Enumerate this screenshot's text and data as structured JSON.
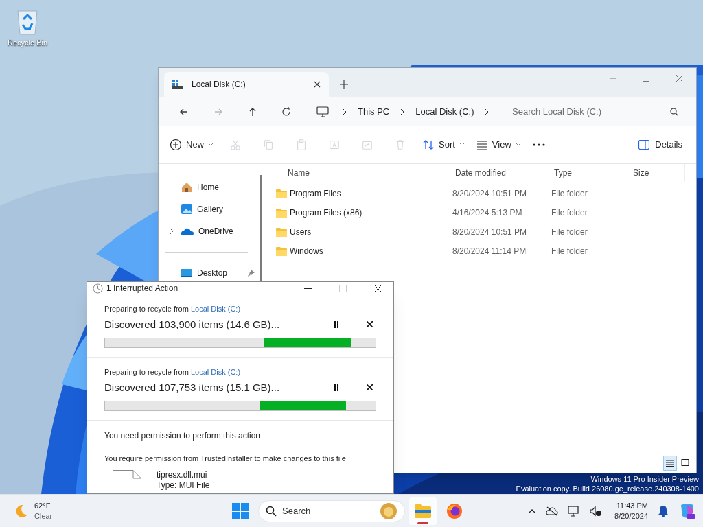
{
  "desktop": {
    "icons": [
      {
        "label": "Recycle Bin"
      }
    ],
    "watermark": [
      "Windows 11 Pro Insider Preview",
      "Evaluation copy. Build 26080.ge_release.240308-1400"
    ]
  },
  "explorer": {
    "tabs": [
      {
        "label": "Local Disk (C:)",
        "selected": true
      }
    ],
    "breadcrumb": [
      "This PC",
      "Local Disk (C:)"
    ],
    "search": {
      "placeholder": "Search Local Disk (C:)"
    },
    "commands": [
      {
        "kind": "new",
        "label": "New",
        "disabled": false
      },
      {
        "kind": "cut",
        "disabled": true
      },
      {
        "kind": "copy",
        "disabled": true
      },
      {
        "kind": "paste",
        "disabled": true
      },
      {
        "kind": "rename",
        "disabled": true
      },
      {
        "kind": "share",
        "disabled": true
      },
      {
        "kind": "delete",
        "disabled": true
      },
      {
        "kind": "sort",
        "label": "Sort",
        "disabled": false
      },
      {
        "kind": "view",
        "label": "View",
        "disabled": false
      },
      {
        "kind": "more",
        "disabled": false
      }
    ],
    "details_button": "Details",
    "sidebar": [
      {
        "kind": "home",
        "label": "Home",
        "expandable": false,
        "pinned": false
      },
      {
        "kind": "gallery",
        "label": "Gallery",
        "expandable": false,
        "pinned": false
      },
      {
        "kind": "onedrive",
        "label": "OneDrive",
        "expandable": true,
        "pinned": false
      },
      {
        "kind": "divider"
      },
      {
        "kind": "desktop",
        "label": "Desktop",
        "expandable": false,
        "pinned": true
      }
    ],
    "columns": [
      "Name",
      "Date modified",
      "Type",
      "Size"
    ],
    "rows": [
      {
        "name": "Program Files",
        "date": "8/20/2024 10:51 PM",
        "type": "File folder"
      },
      {
        "name": "Program Files (x86)",
        "date": "4/16/2024 5:13 PM",
        "type": "File folder"
      },
      {
        "name": "Users",
        "date": "8/20/2024 10:51 PM",
        "type": "File folder"
      },
      {
        "name": "Windows",
        "date": "8/20/2024 11:14 PM",
        "type": "File folder"
      }
    ],
    "view_modes": [
      {
        "kind": "details",
        "selected": true
      },
      {
        "kind": "tiles",
        "selected": false
      }
    ]
  },
  "dialog": {
    "title": "1 Interrupted Action",
    "operations": [
      {
        "prefix": "Preparing to recycle from",
        "source": "Local Disk (C:)",
        "status": "Discovered 103,900 items (14.6 GB)..."
      },
      {
        "prefix": "Preparing to recycle from",
        "source": "Local Disk (C:)",
        "status": "Discovered 107,753 items (15.1 GB)..."
      }
    ],
    "permission": {
      "heading": "You need permission to perform this action",
      "message": "You require permission from TrustedInstaller to make changes to this file",
      "file_name": "tipresx.dll.mui",
      "file_type": "Type: MUI File"
    }
  },
  "taskbar": {
    "weather": {
      "temperature": "62°F",
      "condition": "Clear"
    },
    "search": {
      "placeholder": "Search"
    },
    "apps": [
      {
        "kind": "explorer",
        "running": true
      },
      {
        "kind": "firefox",
        "running": false
      }
    ],
    "time": "11:43 PM",
    "date": "8/20/2024"
  }
}
